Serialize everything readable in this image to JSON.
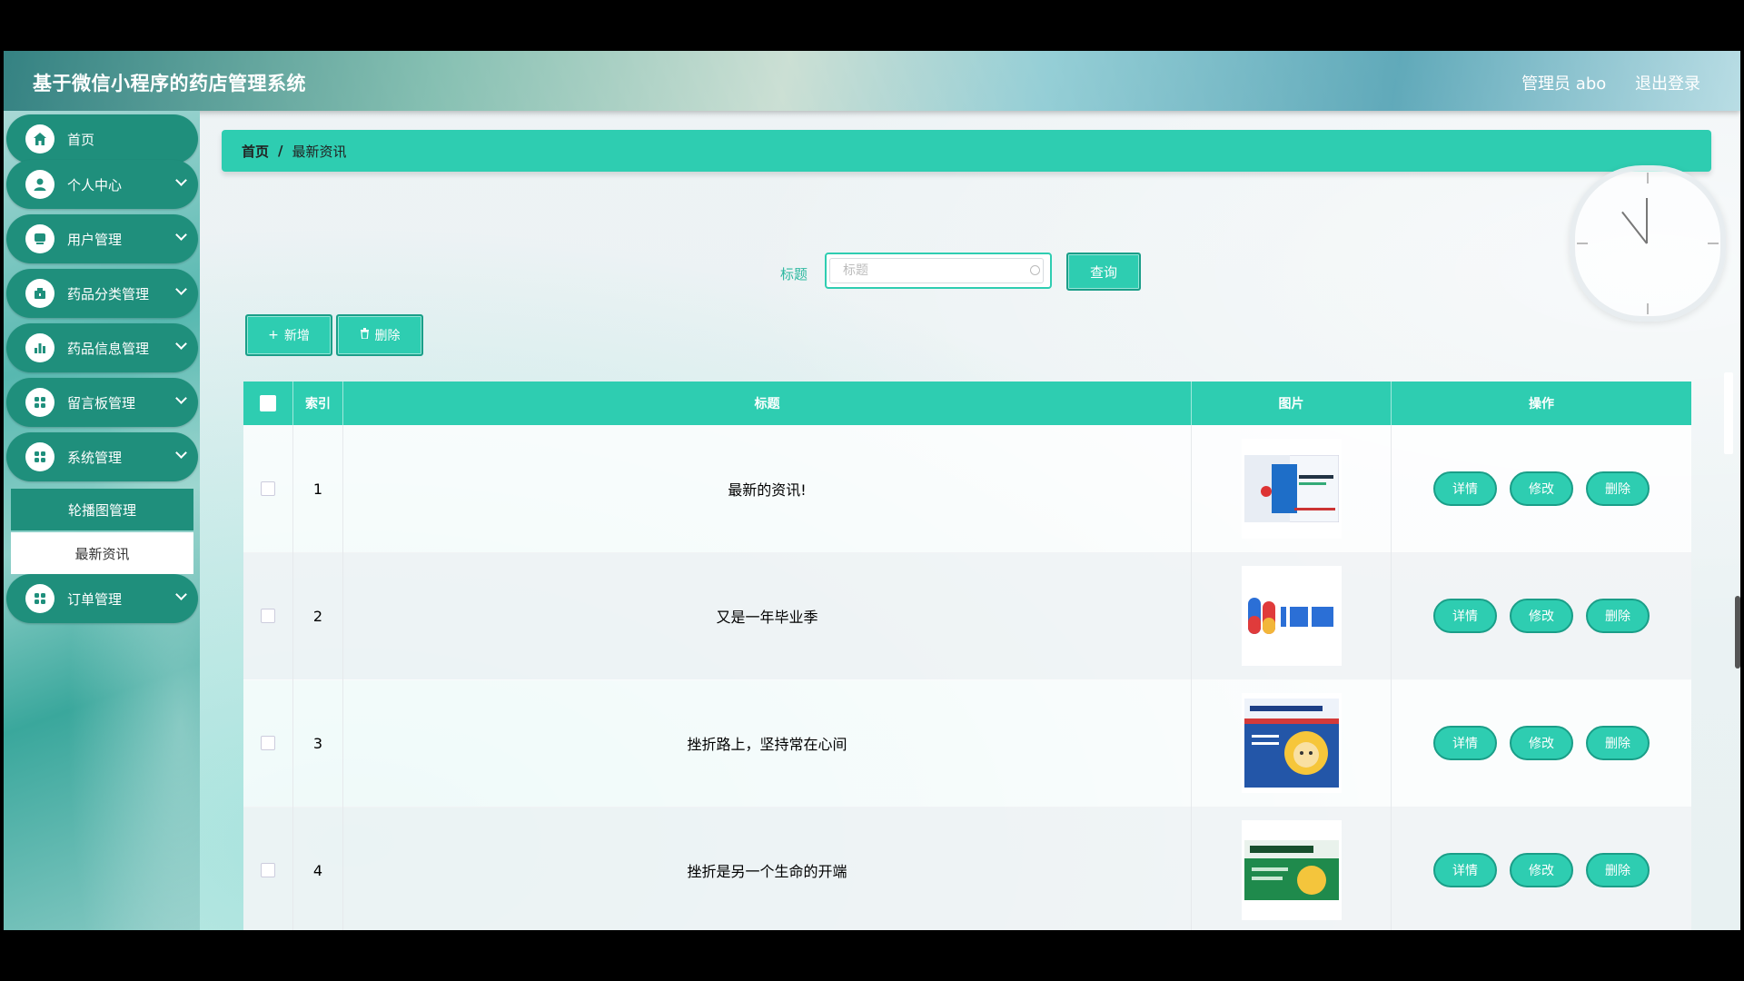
{
  "app": {
    "title": "基于微信小程序的药店管理系统",
    "user": "管理员 abo",
    "logout": "退出登录"
  },
  "sidebar": {
    "items": [
      {
        "label": "首页",
        "icon": "home-icon"
      },
      {
        "label": "个人中心",
        "icon": "user-icon"
      },
      {
        "label": "用户管理",
        "icon": "users-icon"
      },
      {
        "label": "药品分类管理",
        "icon": "category-icon"
      },
      {
        "label": "药品信息管理",
        "icon": "chart-icon"
      },
      {
        "label": "留言板管理",
        "icon": "grid-icon"
      },
      {
        "label": "系统管理",
        "icon": "grid-icon"
      },
      {
        "label": "订单管理",
        "icon": "grid-icon"
      }
    ],
    "subitems": [
      {
        "label": "轮播图管理"
      },
      {
        "label": "最新资讯"
      }
    ]
  },
  "breadcrumb": {
    "home": "首页",
    "separator": "/",
    "current": "最新资讯"
  },
  "search": {
    "label": "标题",
    "placeholder": "标题",
    "button": "查询"
  },
  "toolbar": {
    "add": "新增",
    "delete": "删除"
  },
  "table": {
    "headers": [
      "索引",
      "标题",
      "图片",
      "操作"
    ],
    "rows": [
      {
        "index": "1",
        "title": "最新的资讯!",
        "image": "drug-box-blue"
      },
      {
        "index": "2",
        "title": "又是一年毕业季",
        "image": "1yao-logo"
      },
      {
        "index": "3",
        "title": "挫折路上，坚持常在心间",
        "image": "drug-box-granule"
      },
      {
        "index": "4",
        "title": "挫折是另一个生命的开端",
        "image": "drug-box-green"
      }
    ],
    "actions": {
      "detail": "详情",
      "edit": "修改",
      "delete": "删除"
    }
  },
  "colors": {
    "accent": "#2ecdb1",
    "menu": "#1f8f7c"
  }
}
